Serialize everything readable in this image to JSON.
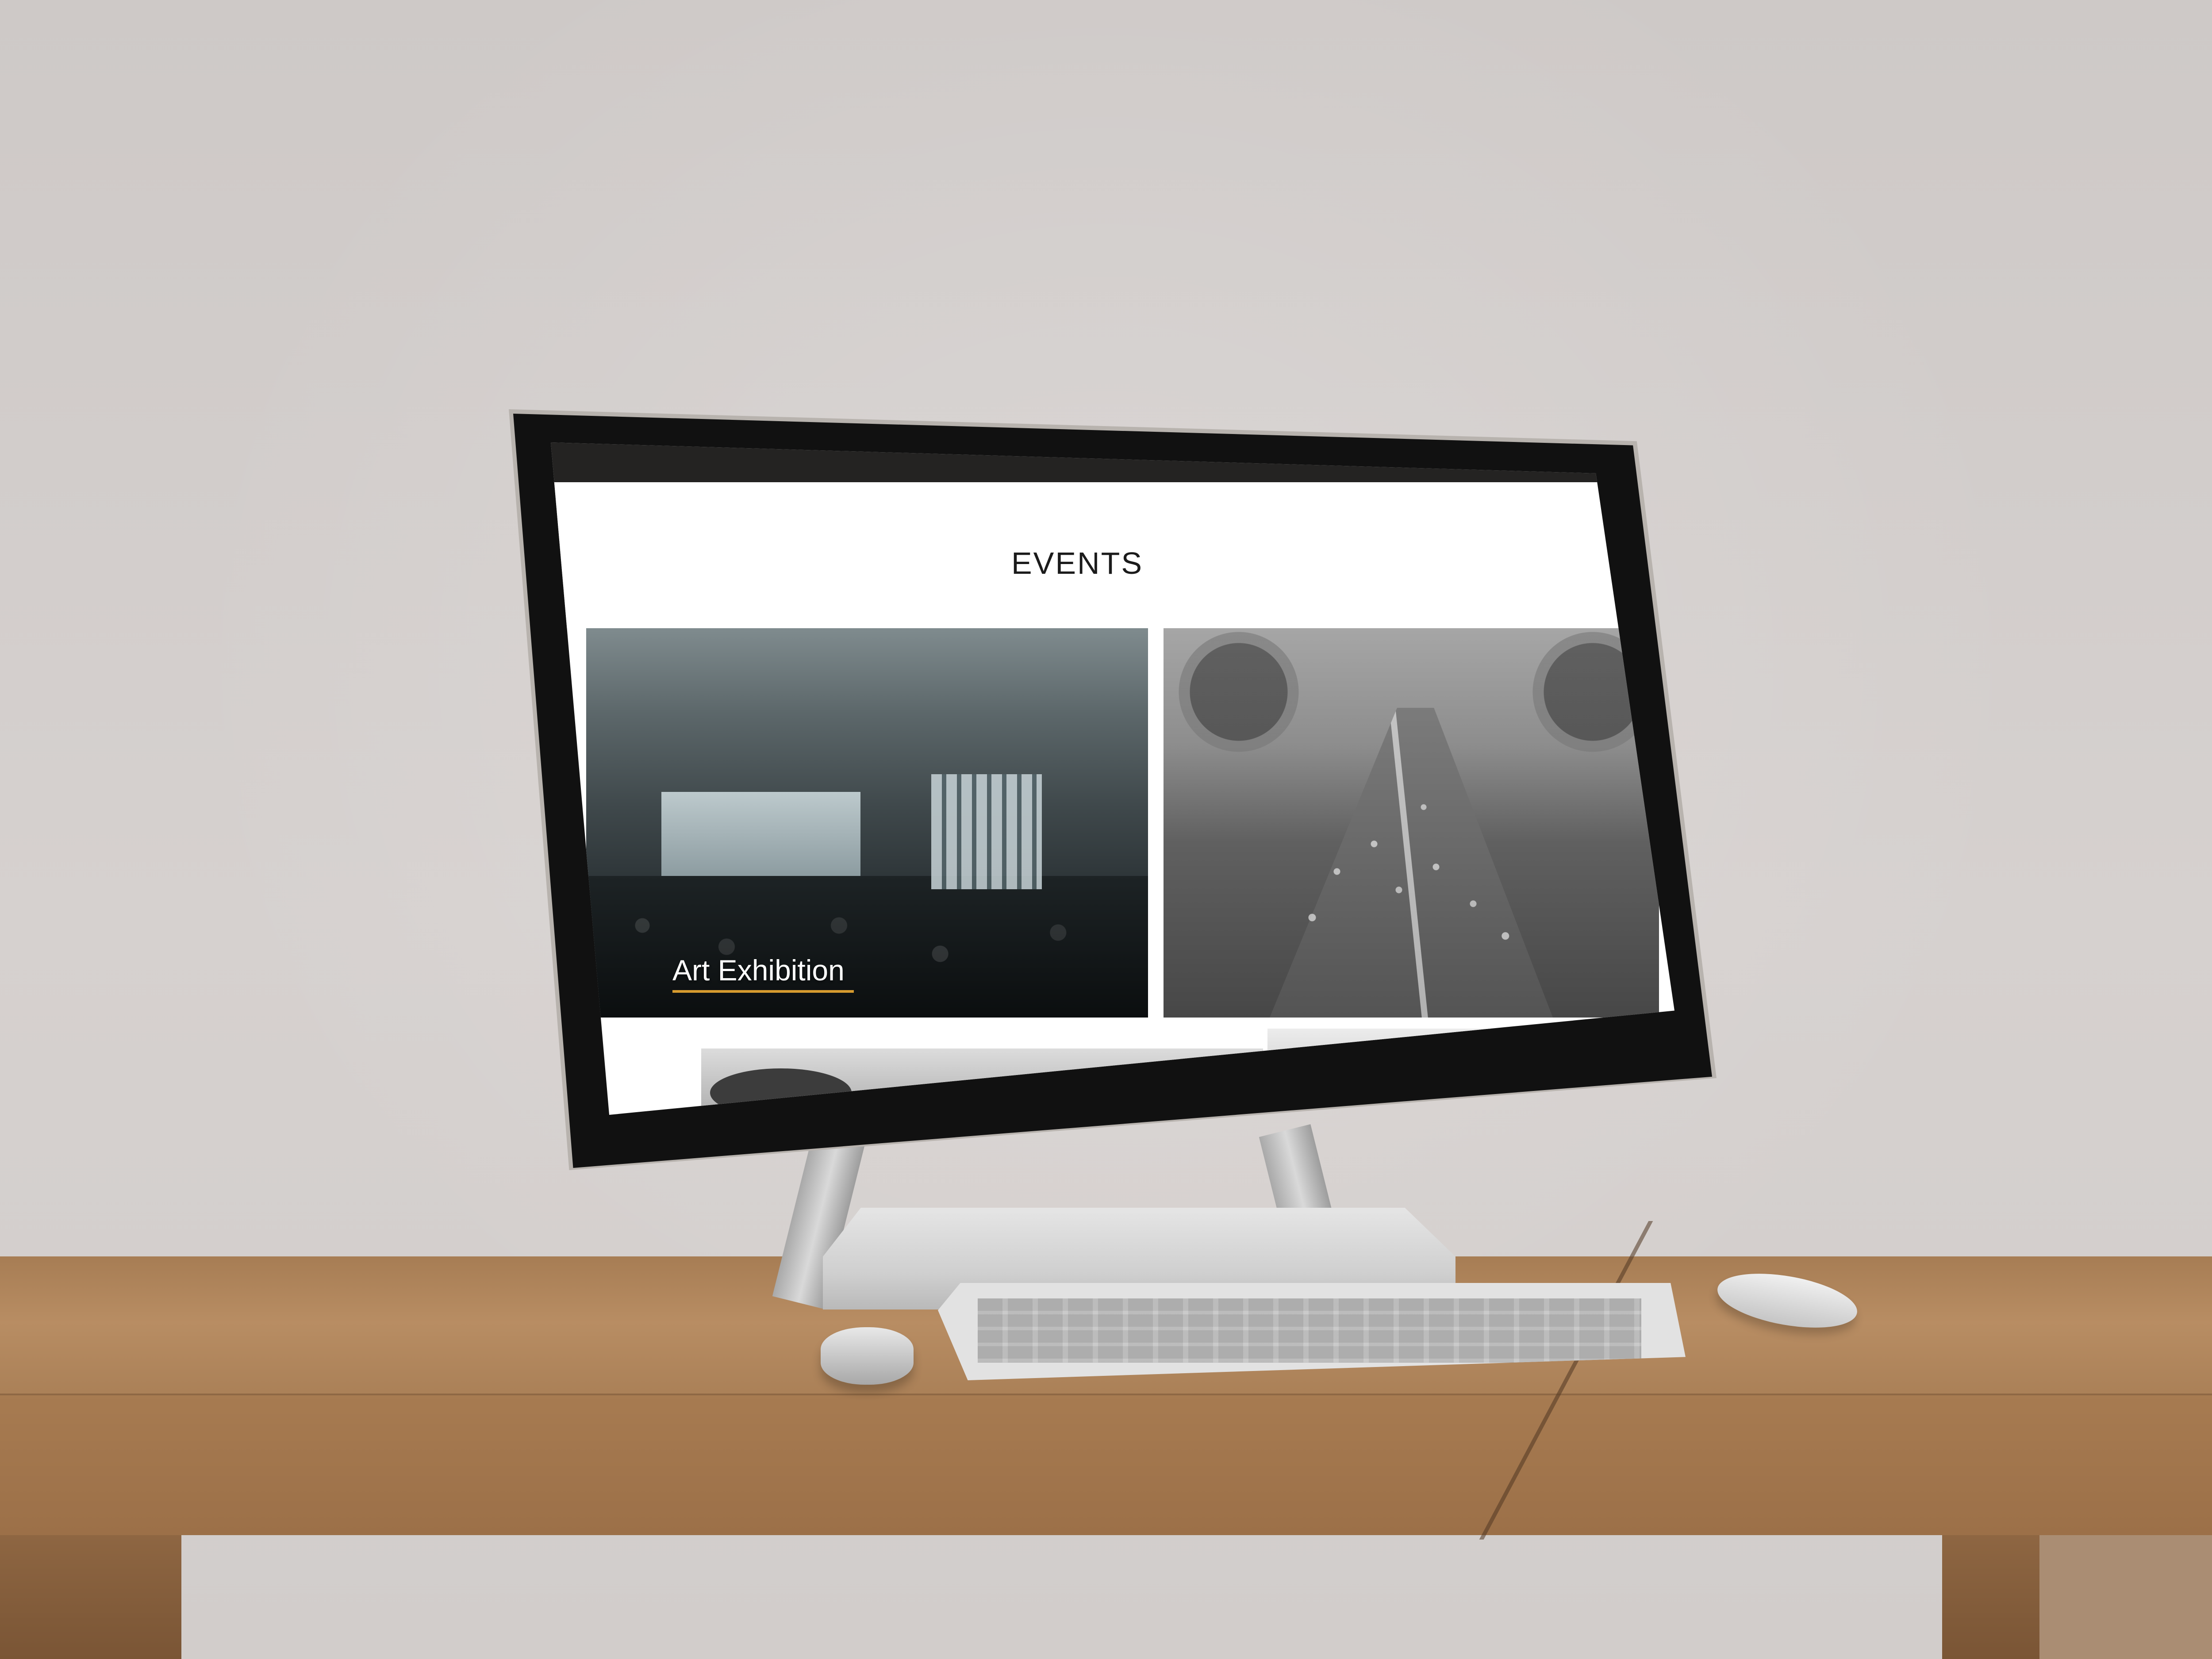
{
  "page": {
    "title": "EVENTS"
  },
  "cards": [
    {
      "label": "Art Exhibition",
      "image": "event-hall-photo"
    },
    {
      "label": "",
      "image": "marathon-photo"
    },
    {
      "label": "",
      "image": "partial-photo"
    },
    {
      "label": "",
      "image": "partial-photo"
    }
  ],
  "colors": {
    "accent": "#d69b2f",
    "header_text": "#1b1b1b",
    "background": "#ffffff"
  }
}
